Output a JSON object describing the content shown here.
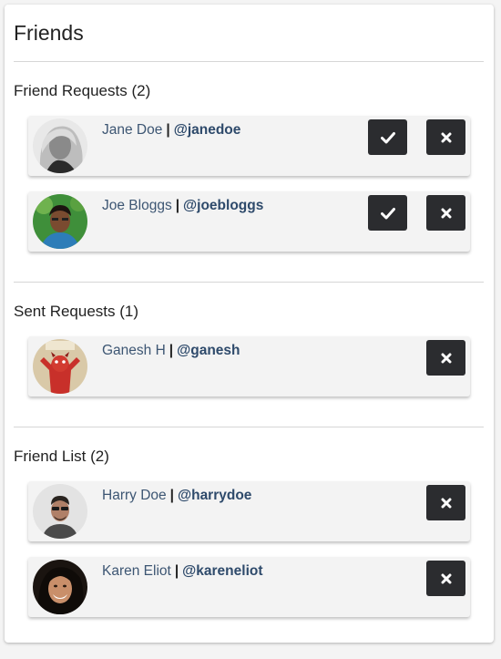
{
  "page": {
    "title": "Friends"
  },
  "sections": {
    "requests": {
      "title": "Friend Requests (2)",
      "items": [
        {
          "name": "Jane Doe",
          "separator": "|",
          "handle": "@janedoe"
        },
        {
          "name": "Joe Bloggs",
          "separator": "|",
          "handle": "@joebloggs"
        }
      ]
    },
    "sent": {
      "title": "Sent Requests (1)",
      "items": [
        {
          "name": "Ganesh H",
          "separator": "|",
          "handle": "@ganesh"
        }
      ]
    },
    "friends": {
      "title": "Friend List (2)",
      "items": [
        {
          "name": "Harry Doe",
          "separator": "|",
          "handle": "@harrydoe"
        },
        {
          "name": "Karen Eliot",
          "separator": "|",
          "handle": "@kareneliot"
        }
      ]
    }
  },
  "icons": {
    "accept": "check-icon",
    "reject": "close-icon"
  },
  "colors": {
    "button_bg": "#2b2c2f",
    "name_text": "#3d5673",
    "handle_text": "#2e4a6b",
    "card_bg": "#f3f3f3"
  }
}
